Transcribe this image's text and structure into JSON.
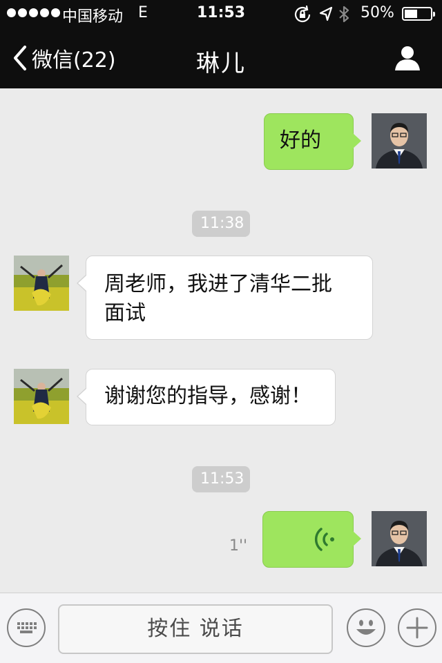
{
  "status_bar": {
    "carrier": "中国移动",
    "network": "E",
    "time": "11:53",
    "battery": "50%",
    "battery_level": 0.5,
    "icons": [
      "rotation-lock-icon",
      "location-arrow-icon",
      "bluetooth-icon"
    ]
  },
  "nav": {
    "back_label": "微信(22)",
    "title": "琳儿",
    "profile_icon": "person-icon"
  },
  "messages": [
    {
      "side": "right",
      "type": "text",
      "text": "好的"
    },
    {
      "type": "timestamp",
      "text": "11:38"
    },
    {
      "side": "left",
      "type": "text",
      "lines": [
        "周老师，我进了清华二批",
        "面试"
      ]
    },
    {
      "side": "left",
      "type": "text",
      "text": "谢谢您的指导，感谢！"
    },
    {
      "type": "timestamp",
      "text": "11:53"
    },
    {
      "side": "right",
      "type": "voice",
      "duration": "1''"
    }
  ],
  "input_bar": {
    "hold_to_talk": "按住 说话",
    "left_icon": "keyboard-icon",
    "emoji_icon": "emoji-icon",
    "plus_icon": "plus-icon"
  },
  "colors": {
    "nav_bg": "#0e0e0e",
    "chat_bg": "#ebebeb",
    "sent_bubble": "#9ee55e",
    "received_bubble": "#ffffff",
    "timestamp_bg": "#cdcdcd"
  }
}
